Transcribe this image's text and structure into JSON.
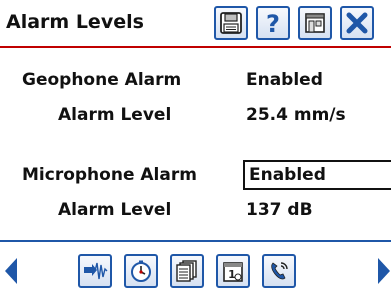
{
  "header": {
    "title": "Alarm Levels"
  },
  "toolbar": {
    "icons": [
      "save-icon",
      "help-icon",
      "home-icon",
      "close-icon"
    ]
  },
  "geophone": {
    "alarm_label": "Geophone Alarm",
    "alarm_value": "Enabled",
    "level_label": "Alarm Level",
    "level_value": "25.4 mm/s"
  },
  "microphone": {
    "alarm_label": "Microphone Alarm",
    "alarm_value": "Enabled",
    "level_label": "Alarm Level",
    "level_value": "137 dB"
  },
  "bottom_nav": {
    "icons": [
      "waveform-icon",
      "timer-icon",
      "documents-icon",
      "calendar-icon",
      "phone-icon"
    ],
    "accent": "#1f57a8"
  },
  "colors": {
    "title_rule": "#c00000",
    "accent": "#1f57a8"
  }
}
